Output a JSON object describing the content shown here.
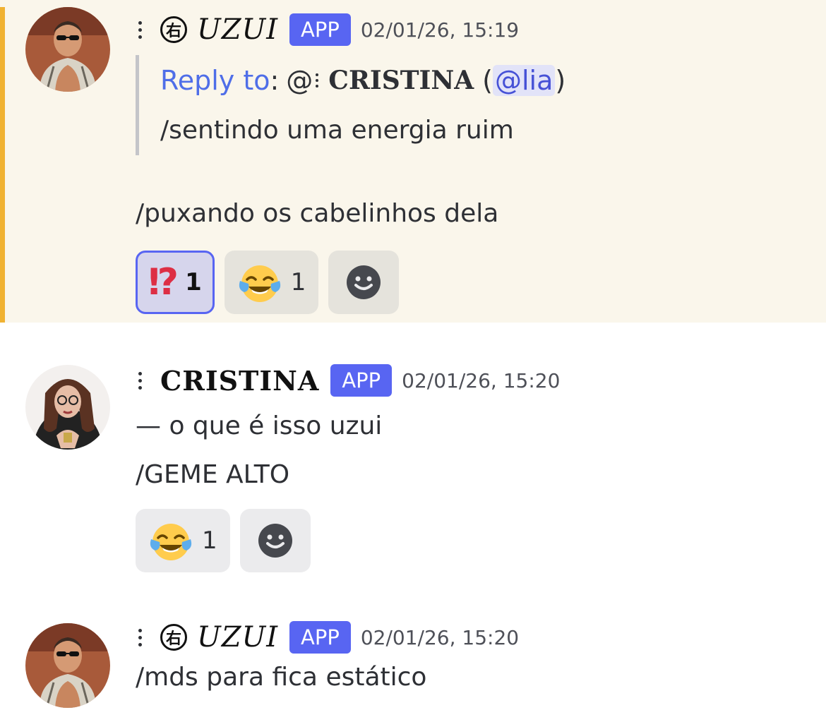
{
  "colors": {
    "highlight_bg": "#faf6eb",
    "accent_bar": "#f0b232",
    "app_badge": "#5865f2",
    "reply_label": "#4f6ee8",
    "mention_text": "#4651d6"
  },
  "messages": [
    {
      "author_symbol": "右",
      "author": "UZUI",
      "badge": "APP",
      "timestamp": "02/01/26, 15:19",
      "reply": {
        "label": "Reply to",
        "colon": ":",
        "at": "@",
        "name": "CRISTINA",
        "open_paren": "(",
        "mention": "@lia",
        "close_paren": ")",
        "text": "/sentindo uma energia ruim"
      },
      "lines": [
        "/puxando os cabelinhos dela"
      ],
      "reactions": [
        {
          "emoji": "exclamation-question-mark",
          "glyph": "⁉",
          "count": "1",
          "active": true
        },
        {
          "emoji": "tears-of-joy",
          "count": "1",
          "active": false
        }
      ],
      "avatar_icon": "avatar-photo-man-sunglasses"
    },
    {
      "author": "CRISTINA",
      "badge": "APP",
      "timestamp": "02/01/26, 15:20",
      "lines": [
        "— o que é isso uzui",
        "/GEME ALTO"
      ],
      "reactions": [
        {
          "emoji": "tears-of-joy",
          "count": "1",
          "active": false
        }
      ],
      "avatar_icon": "avatar-photo-woman-glasses"
    },
    {
      "author_symbol": "右",
      "author": "UZUI",
      "badge": "APP",
      "timestamp": "02/01/26, 15:20",
      "lines": [
        "/mds para fica estático"
      ],
      "avatar_icon": "avatar-photo-man-sunglasses"
    }
  ]
}
